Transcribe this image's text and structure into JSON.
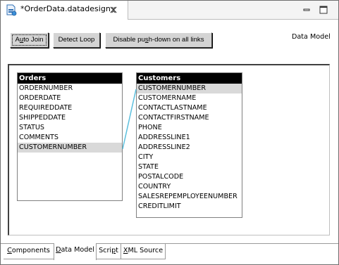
{
  "editor": {
    "title": "*OrderData.datadesign",
    "icons": {
      "file": "datadesign-file-icon",
      "close": "close-icon",
      "minimize": "minimize-icon",
      "maximize": "maximize-icon"
    }
  },
  "toolbar": {
    "auto_join": {
      "pre": "A",
      "mnemonic": "u",
      "post": "to Join"
    },
    "detect_loop": "Detect Loop",
    "disable_pushdown": {
      "pre": "Disable pu",
      "mnemonic": "s",
      "post": "h-down on all links"
    }
  },
  "section_label": "Data Model",
  "tables": {
    "orders": {
      "name": "Orders",
      "columns": [
        "ORDERNUMBER",
        "ORDERDATE",
        "REQUIREDDATE",
        "SHIPPEDDATE",
        "STATUS",
        "COMMENTS",
        "CUSTOMERNUMBER"
      ],
      "selected_index": 6
    },
    "customers": {
      "name": "Customers",
      "columns": [
        "CUSTOMERNUMBER",
        "CUSTOMERNAME",
        "CONTACTLASTNAME",
        "CONTACTFIRSTNAME",
        "PHONE",
        "ADDRESSLINE1",
        "ADDRESSLINE2",
        "CITY",
        "STATE",
        "POSTALCODE",
        "COUNTRY",
        "SALESREPEMPLOYEENUMBER",
        "CREDITLIMIT"
      ],
      "selected_index": 0
    }
  },
  "link_color": "#5bc0de",
  "bottom_tabs": [
    {
      "pre": "",
      "mnemonic": "C",
      "post": "omponents",
      "active": false
    },
    {
      "pre": "",
      "mnemonic": "D",
      "post": "ata Model",
      "active": true
    },
    {
      "pre": "Scri",
      "mnemonic": "p",
      "post": "t",
      "active": false
    },
    {
      "pre": "",
      "mnemonic": "X",
      "post": "ML Source",
      "active": false
    }
  ]
}
